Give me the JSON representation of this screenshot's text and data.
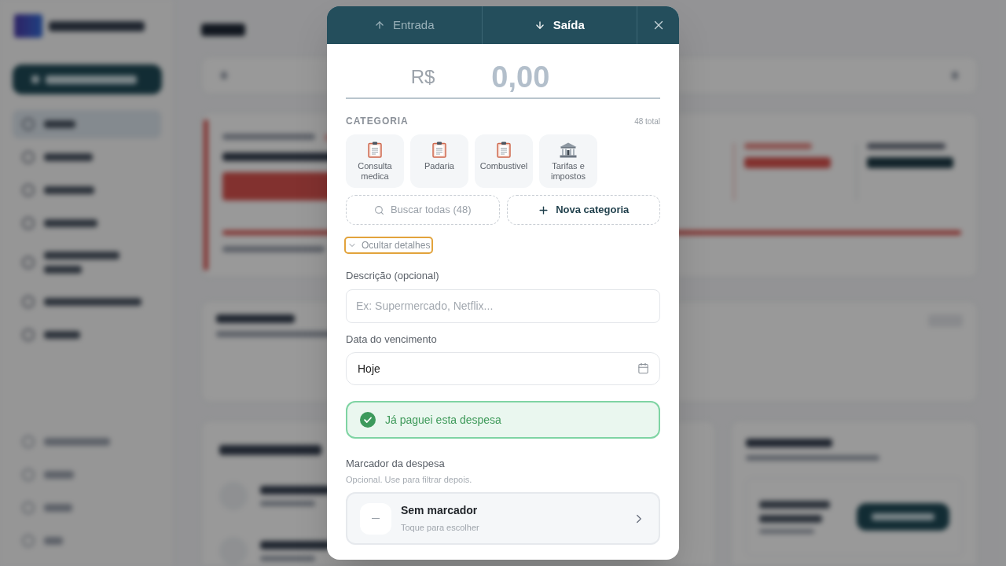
{
  "dialog": {
    "tabs": [
      {
        "label": "Entrada",
        "kind": "income",
        "selected": false
      },
      {
        "label": "Saída",
        "kind": "expense",
        "selected": true
      }
    ],
    "amount": {
      "currency": "R$",
      "placeholder": "0,00"
    },
    "category": {
      "title": "CATEGORIA",
      "total": "48 total",
      "items": [
        {
          "label": "Consulta medica",
          "kind": "clipboard"
        },
        {
          "label": "Padaria",
          "kind": "clipboard"
        },
        {
          "label": "Combustivel",
          "kind": "clipboard"
        },
        {
          "label": "Tarifas e impostos",
          "kind": "bank"
        }
      ],
      "search_button": "Buscar todas (48)",
      "new_button": "Nova categoria"
    },
    "details_toggle": {
      "label": "Ocultar detalhes",
      "expanded": true,
      "focused": true
    },
    "description": {
      "label": "Descrição (opcional)",
      "placeholder": "Ex: Supermercado, Netflix..."
    },
    "due_date": {
      "label": "Data do vencimento",
      "value": "Hoje"
    },
    "paid": {
      "label": "Já paguei esta despesa",
      "checked": true
    },
    "tag": {
      "label": "Marcador da despesa",
      "hint": "Opcional. Use para filtrar depois.",
      "value": "Sem marcador",
      "sub": "Toque para escolher"
    }
  }
}
